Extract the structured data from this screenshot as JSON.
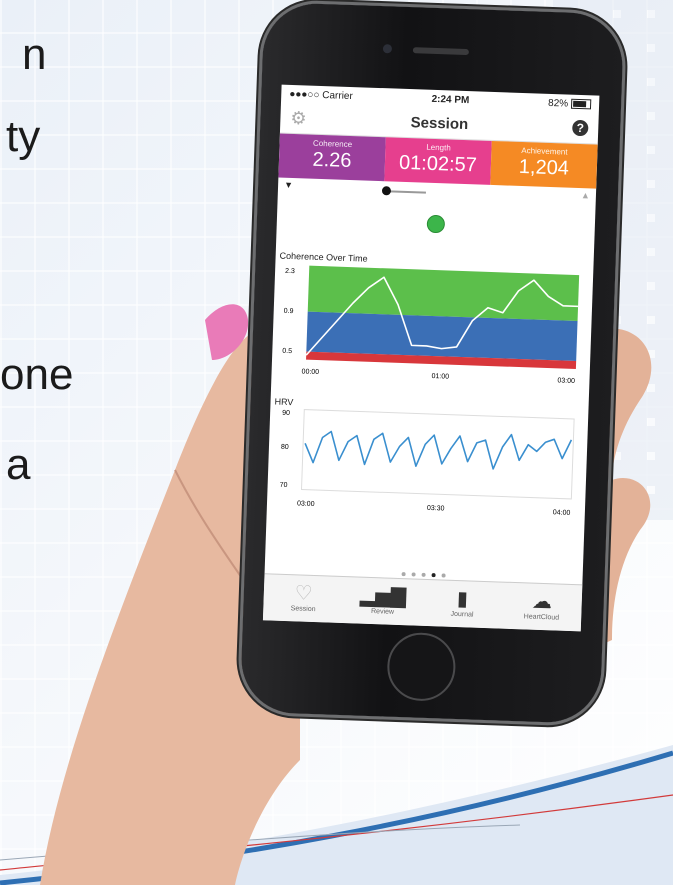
{
  "background_text": [
    "n",
    "ty",
    "one",
    "a"
  ],
  "status_bar": {
    "carrier": "●●●○○ Carrier",
    "time": "2:24 PM",
    "battery": "82%"
  },
  "navbar": {
    "title": "Session",
    "settings_icon": "gear-icon",
    "help_icon": "help-icon"
  },
  "stats": [
    {
      "label": "Coherence",
      "value": "2.26",
      "color": "#9b3f9c"
    },
    {
      "label": "Length",
      "value": "01:02:57",
      "color": "#e63f8e"
    },
    {
      "label": "Achievement",
      "value": "1,204",
      "color": "#f58a24"
    }
  ],
  "coherence_chart": {
    "title": "Coherence Over Time",
    "y_ticks": [
      "2.3",
      "0.9",
      "0.5"
    ],
    "x_ticks": [
      "00:00",
      "01:00",
      "03:00"
    ],
    "bands": {
      "high": "#5cbf4b",
      "mid": "#3b6fb6",
      "low": "#d8373b"
    }
  },
  "hrv_chart": {
    "title": "HRV",
    "y_ticks": [
      "90",
      "80",
      "70"
    ],
    "x_ticks": [
      "03:00",
      "03:30",
      "04:00"
    ],
    "line_color": "#3a8fcf"
  },
  "chart_data": [
    {
      "type": "line",
      "title": "Coherence Over Time",
      "xlabel": "",
      "ylabel": "",
      "x": [
        "00:00",
        "00:10",
        "00:20",
        "00:30",
        "00:40",
        "00:50",
        "01:00",
        "01:10",
        "01:20",
        "01:30",
        "01:40",
        "01:50",
        "02:00",
        "02:10",
        "02:20",
        "02:30",
        "02:40",
        "02:50",
        "03:00"
      ],
      "values": [
        0.5,
        0.9,
        1.3,
        1.7,
        2.05,
        2.3,
        1.7,
        0.8,
        0.8,
        0.75,
        0.8,
        1.4,
        1.7,
        1.6,
        2.1,
        2.35,
        2.0,
        1.8,
        1.8
      ],
      "ylim": [
        0.4,
        2.5
      ],
      "grid": false
    },
    {
      "type": "line",
      "title": "HRV",
      "xlabel": "",
      "ylabel": "",
      "x_range": [
        "03:00",
        "04:00"
      ],
      "values": [
        82,
        76,
        84,
        86,
        77,
        83,
        85,
        76,
        84,
        86,
        77,
        82,
        85,
        76,
        83,
        86,
        77,
        82,
        86,
        78,
        84,
        85,
        76,
        83,
        87,
        79,
        84,
        82,
        85,
        86,
        80,
        86
      ],
      "ylim": [
        68,
        92
      ],
      "grid": false
    }
  ],
  "pager": {
    "count": 5,
    "active_index": 3
  },
  "tabbar": [
    {
      "label": "Session",
      "icon": "heart-icon"
    },
    {
      "label": "Review",
      "icon": "bar-chart-icon"
    },
    {
      "label": "Journal",
      "icon": "journal-icon"
    },
    {
      "label": "HeartCloud",
      "icon": "cloud-icon"
    }
  ]
}
